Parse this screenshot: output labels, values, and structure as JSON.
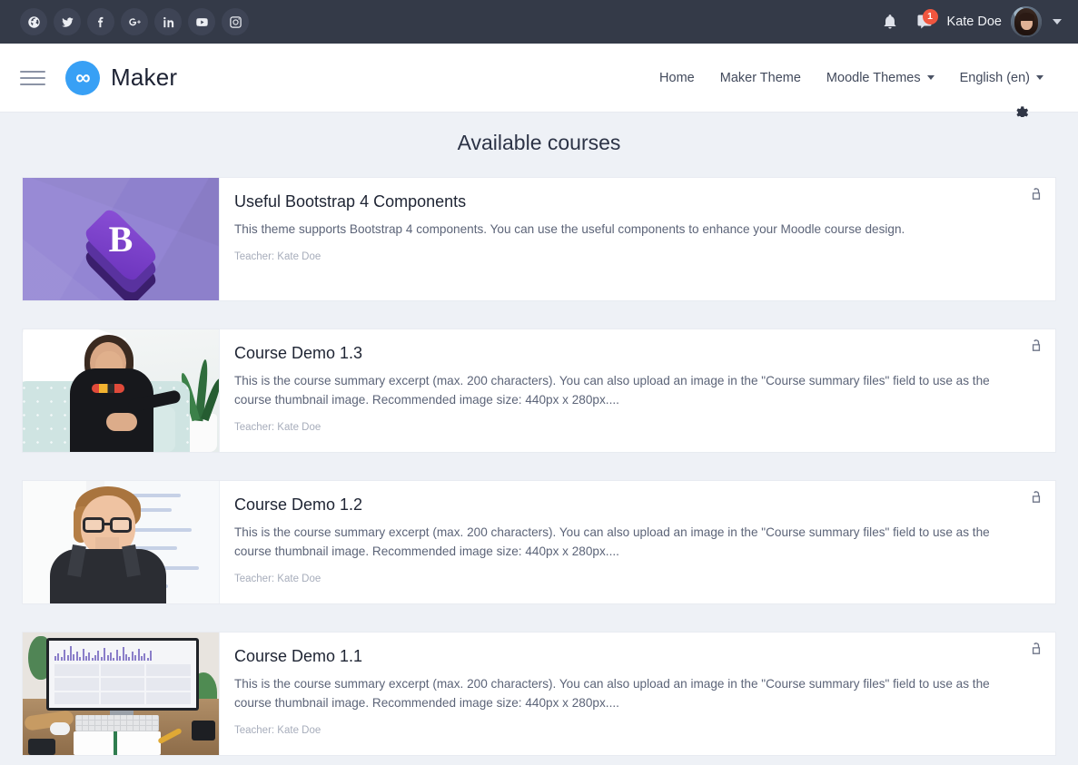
{
  "topbar": {
    "social": [
      {
        "name": "website-icon",
        "label": "Website"
      },
      {
        "name": "twitter-icon",
        "label": "Twitter"
      },
      {
        "name": "facebook-icon",
        "label": "Facebook"
      },
      {
        "name": "google-plus-icon",
        "label": "Google Plus"
      },
      {
        "name": "linkedin-icon",
        "label": "LinkedIn"
      },
      {
        "name": "youtube-icon",
        "label": "YouTube"
      },
      {
        "name": "instagram-icon",
        "label": "Instagram"
      }
    ],
    "notifications_label": "Notifications",
    "messages_label": "Messages",
    "message_badge": "1",
    "user_name": "Kate Doe",
    "bg_color": "#343a48"
  },
  "header": {
    "brand_name": "Maker",
    "brand_logo_glyph": "∞",
    "brand_color": "#38a0f5",
    "nav": [
      {
        "label": "Home",
        "has_caret": false
      },
      {
        "label": "Maker Theme",
        "has_caret": false
      },
      {
        "label": "Moodle Themes",
        "has_caret": true
      },
      {
        "label": "English (en)",
        "has_caret": true
      }
    ]
  },
  "main": {
    "page_title": "Available courses",
    "courses": [
      {
        "title": "Useful Bootstrap 4 Components",
        "summary": "This theme supports Bootstrap 4 components. You can use the useful components to enhance your Moodle course design.",
        "teacher": "Teacher: Kate Doe",
        "thumb": "bootstrap-logo-thumbnail",
        "lock": "unlocked-padlock-icon"
      },
      {
        "title": "Course Demo 1.3",
        "summary": "This is the course summary excerpt (max. 200 characters). You can also upload an image in the \"Course summary files\" field to use as the course thumbnail image. Recommended image size: 440px x 280px....",
        "teacher": "Teacher: Kate Doe",
        "thumb": "woman-on-sofa-photo",
        "lock": "unlocked-padlock-icon"
      },
      {
        "title": "Course Demo 1.2",
        "summary": "This is the course summary excerpt (max. 200 characters). You can also upload an image in the \"Course summary files\" field to use as the course thumbnail image. Recommended image size: 440px x 280px....",
        "teacher": "Teacher: Kate Doe",
        "thumb": "woman-with-glasses-photo",
        "lock": "unlocked-padlock-icon"
      },
      {
        "title": "Course Demo 1.1",
        "summary": "This is the course summary excerpt (max. 200 characters). You can also upload an image in the \"Course summary files\" field to use as the course thumbnail image. Recommended image size: 440px x 280px....",
        "teacher": "Teacher: Kate Doe",
        "thumb": "desk-with-monitor-photo",
        "lock": "unlocked-padlock-icon"
      }
    ]
  },
  "colors": {
    "page_bg": "#eef1f6",
    "card_bg": "#ffffff",
    "badge": "#f0563f",
    "text_dark": "#1e2433",
    "text_muted": "#5c6478"
  }
}
